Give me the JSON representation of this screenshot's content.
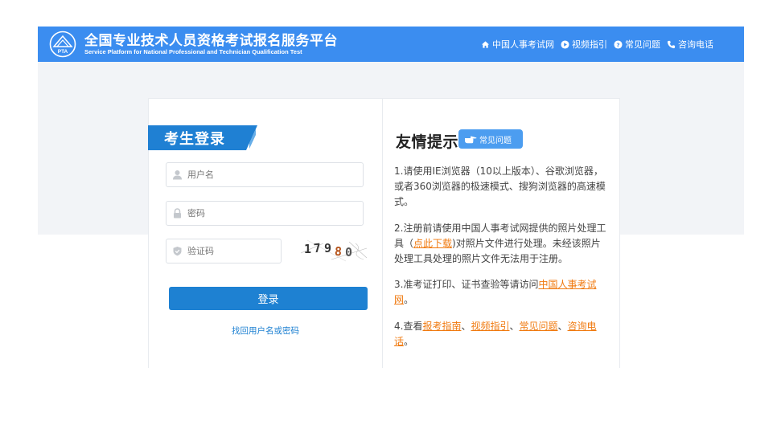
{
  "header": {
    "title_cn": "全国专业技术人员资格考试报名服务平台",
    "title_en": "Service Platform for National Professional and Technician Qualification Test",
    "logo_text": "PTA",
    "nav": [
      {
        "label": "中国人事考试网",
        "icon": "home-icon"
      },
      {
        "label": "视频指引",
        "icon": "play-icon"
      },
      {
        "label": "常见问题",
        "icon": "question-icon"
      },
      {
        "label": "咨询电话",
        "icon": "phone-icon"
      }
    ]
  },
  "login": {
    "tab_title": "考生登录",
    "username_placeholder": "用户名",
    "password_placeholder": "密码",
    "captcha_placeholder": "验证码",
    "captcha_code": [
      "1",
      "7",
      "9",
      "8",
      "0"
    ],
    "submit_label": "登录",
    "forgot_label": "找回用户名或密码"
  },
  "tips": {
    "title": "友情提示",
    "faq_badge": "常见问题",
    "items": [
      {
        "text": "1.请使用IE浏览器（10以上版本）、谷歌浏览器，或者360浏览器的极速模式、搜狗浏览器的高速模式。"
      },
      {
        "before": "2.注册前请使用中国人事考试网提供的照片处理工具（",
        "link": "点此下载",
        "after": ")对照片文件进行处理。未经该照片处理工具处理的照片文件无法用于注册。"
      },
      {
        "before": "3.准考证打印、证书查验等请访问",
        "link": "中国人事考试网",
        "after": "。"
      },
      {
        "before": "4.查看",
        "links": [
          "报考指南",
          "视频指引",
          "常见问题",
          "咨询电话"
        ],
        "separator": "、",
        "after": "。"
      }
    ]
  },
  "colors": {
    "header_bg": "#3b8df0",
    "primary": "#1e81d2",
    "link_orange": "#f07a10",
    "band_bg": "#f2f4f7"
  }
}
